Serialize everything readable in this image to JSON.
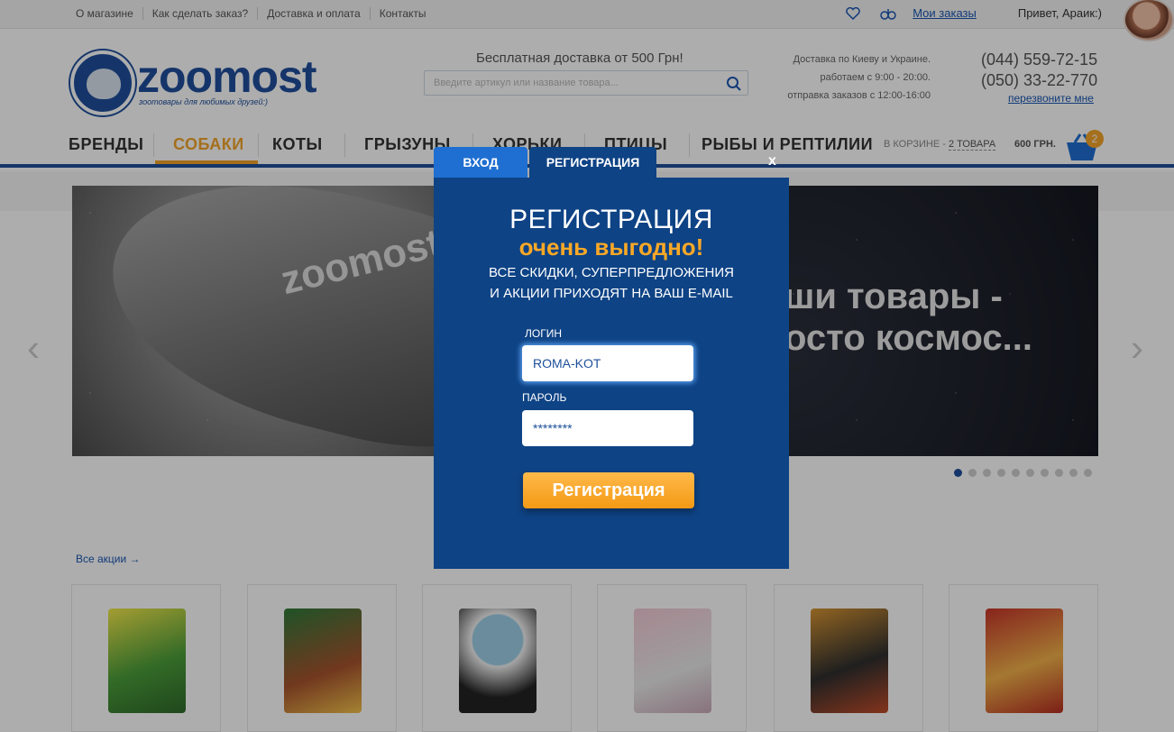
{
  "topbar": {
    "links": [
      "О магазине",
      "Как сделать заказ?",
      "Доставка и оплата",
      "Контакты"
    ],
    "my_orders": "Мои заказы",
    "greeting": "Привет, Араик:)"
  },
  "header": {
    "logo_word": "zoomost",
    "logo_tagline": "зоотовары для любимых друзей:)",
    "free_delivery": "Бесплатная доставка от 500 Грн!",
    "search_placeholder": "Введите артикул или название товара...",
    "info_lines": [
      "Доставка по Киеву и Украине.",
      "работаем с 9:00 - 20:00.",
      "отправка заказов с 12:00-16:00"
    ],
    "phones": [
      "(044) 559-72-15",
      "(050) 33-22-770"
    ],
    "callback": "перезвоните мне"
  },
  "nav": {
    "items": [
      "БРЕНДЫ",
      "СОБАКИ",
      "КОТЫ",
      "ГРЫЗУНЫ",
      "ХОРЬКИ",
      "ПТИЦЫ",
      "РЫБЫ И РЕПТИЛИИ"
    ],
    "active": "СОБАКИ",
    "cart_label": "В КОРЗИНЕ -",
    "cart_count": "2 ТОВАРА",
    "cart_sum": "600 ГРН.",
    "badge": "2"
  },
  "banner": {
    "ship_text": "zoomost",
    "slogan_line1": "ши товары -",
    "slogan_line2": "осто космос...",
    "dots_total": 10,
    "dot_active": 1
  },
  "promo": {
    "all_link": "Все акции →"
  },
  "products": [
    "product-1",
    "product-2",
    "product-3",
    "product-4",
    "product-5",
    "product-6"
  ],
  "modal": {
    "tab_login": "ВХОД",
    "tab_register": "РЕГИСТРАЦИЯ",
    "close": "x",
    "title": "РЕГИСТРАЦИЯ",
    "subtitle": "очень выгодно!",
    "desc_line1": "ВСЕ СКИДКИ, СУПЕРПРЕДЛОЖЕНИЯ",
    "desc_line2": "И АКЦИИ ПРИХОДЯТ НА ВАШ E-MAIL",
    "login_label": "ЛОГИН",
    "login_value": "ROMA-KOT",
    "password_label": "ПАРОЛЬ",
    "password_value": "********",
    "submit": "Регистрация"
  },
  "colors": {
    "brand_blue": "#1f4f9c",
    "modal_bg": "#0e4385",
    "accent_orange": "#f9a826"
  }
}
